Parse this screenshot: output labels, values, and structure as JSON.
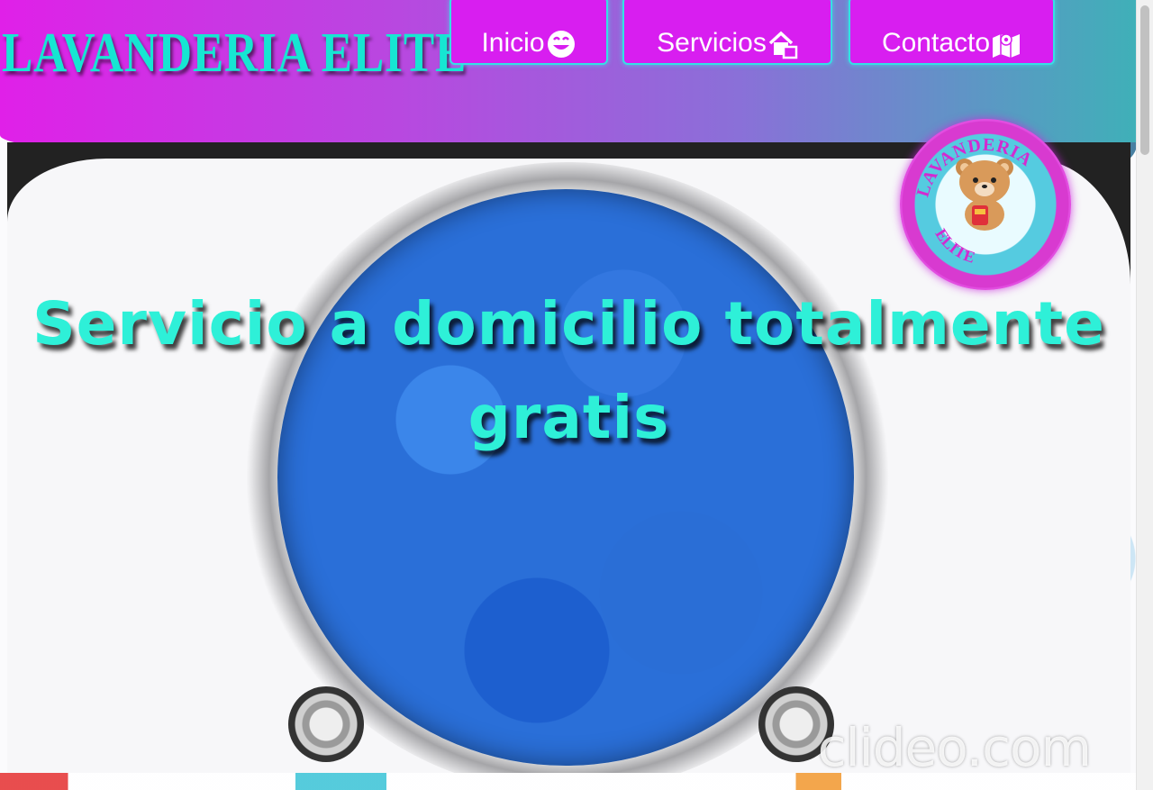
{
  "brand": {
    "name": "LAVANDERIA ELITE"
  },
  "nav": {
    "items": [
      {
        "label": "Inicio",
        "icon": "smiley-icon"
      },
      {
        "label": "Servicios",
        "icon": "house-icon"
      },
      {
        "label": "Contacto",
        "icon": "map-icon"
      }
    ]
  },
  "hero": {
    "title": "Servicio a domicilio totalmente gratis",
    "watermark": "clideo.com"
  },
  "logo": {
    "top_text": "LAVANDERIA",
    "bottom_text": "ELITE"
  },
  "colors": {
    "brand_text": "#16e6d2",
    "nav_bg": "#d81ef0",
    "nav_border": "#35e0e4",
    "header_start": "#e020e8",
    "header_end": "#3fb0b8"
  }
}
